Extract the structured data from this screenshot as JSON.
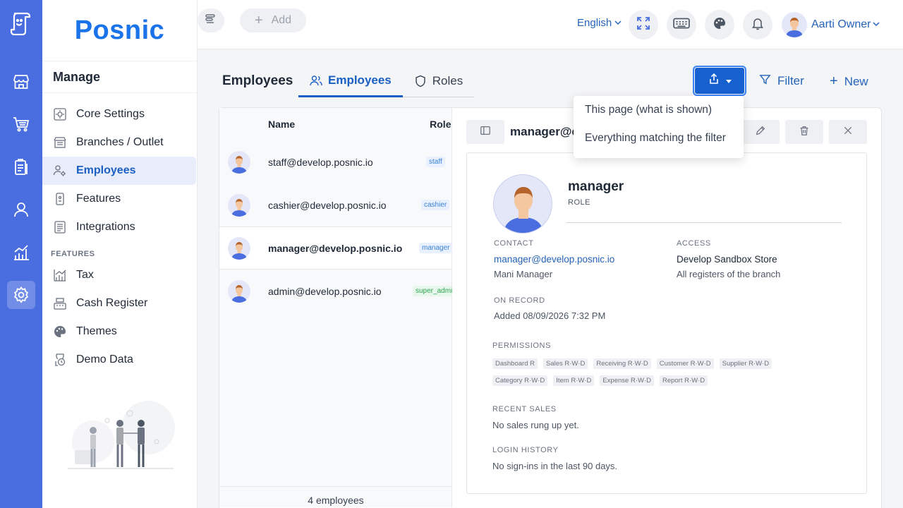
{
  "brand": {
    "name": "Posnic"
  },
  "rail": {
    "icons": [
      "store-icon",
      "cart-icon",
      "clipboard-icon",
      "person-icon",
      "chart-icon",
      "settings-icon"
    ],
    "active": "settings-icon"
  },
  "sidebar": {
    "section_title": "Manage",
    "items": [
      {
        "label": "Core Settings",
        "icon": "settings-gear-icon"
      },
      {
        "label": "Branches / Outlet",
        "icon": "building-icon"
      },
      {
        "label": "Employees",
        "icon": "users-gear-icon",
        "active": true
      },
      {
        "label": "Features",
        "icon": "device-icon"
      },
      {
        "label": "Integrations",
        "icon": "list-icon"
      }
    ],
    "features_label": "FEATURES",
    "feature_items": [
      {
        "label": "Tax",
        "icon": "tax-chart-icon"
      },
      {
        "label": "Cash Register",
        "icon": "register-icon"
      },
      {
        "label": "Themes",
        "icon": "palette-icon"
      },
      {
        "label": "Demo Data",
        "icon": "demo-data-icon"
      }
    ]
  },
  "topbar": {
    "add_label": "Add",
    "language": "English",
    "user_name": "Aarti Owner"
  },
  "page": {
    "title": "Employees",
    "tabs": [
      {
        "label": "Employees",
        "active": true
      },
      {
        "label": "Roles",
        "active": false
      }
    ],
    "filter_label": "Filter",
    "new_label": "New"
  },
  "export_menu": {
    "items": [
      "This page (what is shown)",
      "Everything matching the filter"
    ]
  },
  "list": {
    "columns": {
      "name": "Name",
      "role": "Role"
    },
    "rows": [
      {
        "email": "staff@develop.posnic.io",
        "role": "staff",
        "color": "#3b82d6"
      },
      {
        "email": "cashier@develop.posnic.io",
        "role": "cashier",
        "color": "#3b82d6"
      },
      {
        "email": "manager@develop.posnic.io",
        "role": "manager",
        "color": "#3b82d6",
        "selected": true
      },
      {
        "email": "admin@develop.posnic.io",
        "role": "super_admin",
        "color": "#2fa653"
      }
    ],
    "footer": "4 employees"
  },
  "detail": {
    "header_title": "manager@develop.posnic.io",
    "name": "manager",
    "role_label": "ROLE",
    "contact_label": "CONTACT",
    "contact_email": "manager@develop.posnic.io",
    "contact_name": "Mani Manager",
    "access_label": "ACCESS",
    "access_store": "Develop Sandbox Store",
    "access_scope": "All registers of the branch",
    "record_label": "ON RECORD",
    "record_value": "Added 08/09/2026 7:32 PM",
    "permissions_label": "PERMISSIONS",
    "permissions": [
      "Dashboard R",
      "Sales R·W·D",
      "Receiving R·W·D",
      "Customer R·W·D",
      "Supplier R·W·D",
      "Category R·W·D",
      "Item R·W·D",
      "Expense R·W·D",
      "Report R·W·D"
    ],
    "sales_label": "RECENT SALES",
    "sales_value": "No sales rung up yet.",
    "login_label": "LOGIN HISTORY",
    "login_value": "No sign-ins in the last 90 days."
  },
  "colors": {
    "rail": "#4a6ee0",
    "brand": "#1a73e8",
    "primary": "#1660d0",
    "accent_text": "#2563b8"
  }
}
